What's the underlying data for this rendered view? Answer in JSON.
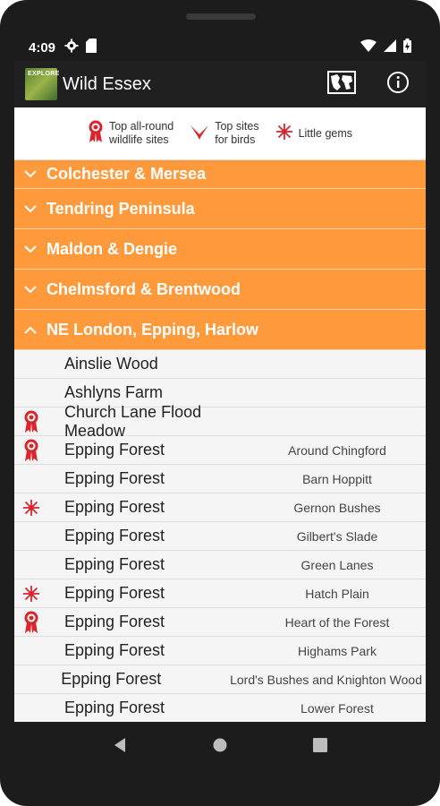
{
  "status": {
    "time": "4:09"
  },
  "appbar": {
    "title": "Wild Essex",
    "logo_text": "EXPLORE"
  },
  "legend": [
    {
      "icon": "rosette-icon",
      "line1": "Top all-round",
      "line2": "wildlife sites"
    },
    {
      "icon": "bird-icon",
      "line1": "Top sites",
      "line2": "for birds"
    },
    {
      "icon": "sparkle-icon",
      "line1": "Little gems",
      "line2": ""
    }
  ],
  "groups": [
    {
      "label": "Colchester & Mersea",
      "expanded": false
    },
    {
      "label": "Tendring Peninsula",
      "expanded": false
    },
    {
      "label": "Maldon & Dengie",
      "expanded": false
    },
    {
      "label": "Chelmsford & Brentwood",
      "expanded": false
    },
    {
      "label": "NE London, Epping, Harlow",
      "expanded": true
    }
  ],
  "sites": [
    {
      "name": "Ainslie Wood",
      "sub": "",
      "badge": ""
    },
    {
      "name": "Ashlyns Farm",
      "sub": "",
      "badge": ""
    },
    {
      "name": "Church Lane Flood Meadow",
      "sub": "",
      "badge": "rosette-icon"
    },
    {
      "name": "Epping Forest",
      "sub": "Around Chingford",
      "badge": "rosette-icon"
    },
    {
      "name": "Epping Forest",
      "sub": "Barn Hoppitt",
      "badge": ""
    },
    {
      "name": "Epping Forest",
      "sub": "Gernon Bushes",
      "badge": "sparkle-icon"
    },
    {
      "name": "Epping Forest",
      "sub": "Gilbert's Slade",
      "badge": ""
    },
    {
      "name": "Epping Forest",
      "sub": "Green Lanes",
      "badge": ""
    },
    {
      "name": "Epping Forest",
      "sub": "Hatch Plain",
      "badge": "sparkle-icon"
    },
    {
      "name": "Epping Forest",
      "sub": "Heart of the Forest",
      "badge": "rosette-icon"
    },
    {
      "name": "Epping Forest",
      "sub": "Highams Park",
      "badge": ""
    },
    {
      "name": "Epping Forest",
      "sub": "Lord's Bushes and Knighton Wood",
      "badge": ""
    },
    {
      "name": "Epping Forest",
      "sub": "Lower Forest",
      "badge": ""
    }
  ],
  "colors": {
    "accent": "#ff9a3c",
    "badge": "#d8262f",
    "appbar": "#202020"
  }
}
